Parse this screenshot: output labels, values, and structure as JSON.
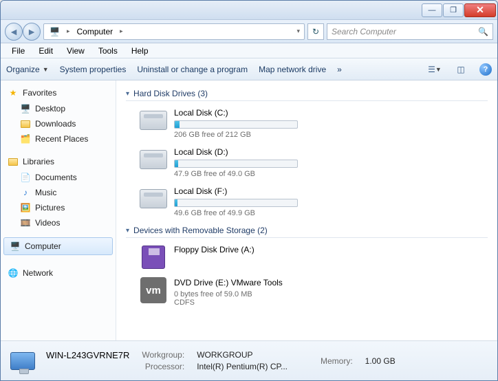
{
  "titlebar": {
    "min": "—",
    "max": "❐",
    "close": "✕"
  },
  "nav": {
    "back": "◄",
    "fwd": "►",
    "location": "Computer",
    "chev": "▸",
    "dropdown": "▾",
    "refresh": "↻"
  },
  "search": {
    "placeholder": "Search Computer",
    "icon": "🔍"
  },
  "menu": {
    "file": "File",
    "edit": "Edit",
    "view": "View",
    "tools": "Tools",
    "help": "Help"
  },
  "toolbar": {
    "organize": "Organize",
    "sysprops": "System properties",
    "uninstall": "Uninstall or change a program",
    "mapdrive": "Map network drive",
    "more": "»",
    "help": "?"
  },
  "sidebar": {
    "favorites": {
      "label": "Favorites",
      "items": [
        "Desktop",
        "Downloads",
        "Recent Places"
      ]
    },
    "libraries": {
      "label": "Libraries",
      "items": [
        "Documents",
        "Music",
        "Pictures",
        "Videos"
      ]
    },
    "computer": {
      "label": "Computer"
    },
    "network": {
      "label": "Network"
    }
  },
  "content": {
    "hdd_header": "Hard Disk Drives (3)",
    "rem_header": "Devices with Removable Storage (2)",
    "drives": {
      "c": {
        "name": "Local Disk (C:)",
        "free": "206 GB free of 212 GB",
        "pct": 4
      },
      "d": {
        "name": "Local Disk (D:)",
        "free": "47.9 GB free of 49.0 GB",
        "pct": 3
      },
      "f": {
        "name": "Local Disk (F:)",
        "free": "49.6 GB free of 49.9 GB",
        "pct": 2
      }
    },
    "floppy": {
      "name": "Floppy Disk Drive (A:)"
    },
    "dvd": {
      "name": "DVD Drive (E:) VMware Tools",
      "free": "0 bytes free of 59.0 MB",
      "fs": "CDFS",
      "badge": "vm"
    }
  },
  "details": {
    "name": "WIN-L243GVRNE7R",
    "workgroup_lbl": "Workgroup:",
    "workgroup": "WORKGROUP",
    "memory_lbl": "Memory:",
    "memory": "1.00 GB",
    "processor_lbl": "Processor:",
    "processor": "Intel(R) Pentium(R) CP..."
  }
}
